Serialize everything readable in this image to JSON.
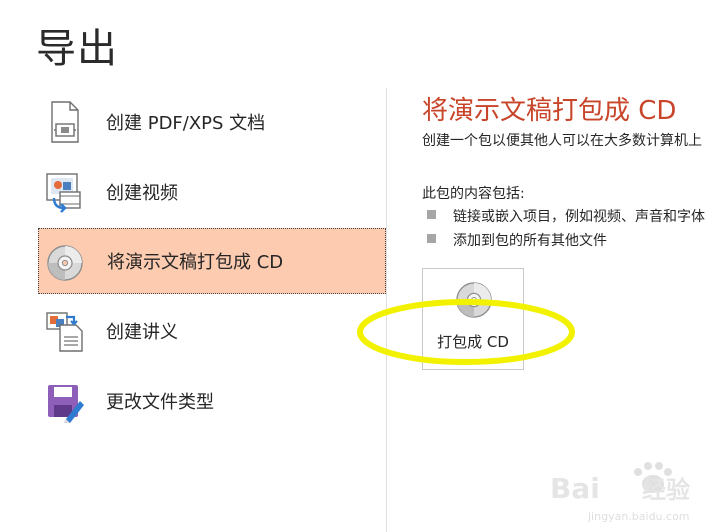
{
  "page": {
    "title": "导出"
  },
  "menu": {
    "items": [
      {
        "label": "创建 PDF/XPS 文档",
        "icon": "pdf-document-icon"
      },
      {
        "label": "创建视频",
        "icon": "video-icon"
      },
      {
        "label": "将演示文稿打包成 CD",
        "icon": "cd-icon"
      },
      {
        "label": "创建讲义",
        "icon": "handout-icon"
      },
      {
        "label": "更改文件类型",
        "icon": "save-as-icon"
      }
    ],
    "selected_index": 2
  },
  "detail": {
    "title": "将演示文稿打包成 CD",
    "description": "创建一个包以便其他人可以在大多数计算机上",
    "contents_heading": "此包的内容包括:",
    "bullets": [
      "链接或嵌入项目，例如视频、声音和字体",
      "添加到包的所有其他文件"
    ],
    "pack_button_label": "打包成 CD"
  },
  "colors": {
    "accent_title": "#c9452a",
    "selected_bg": "#fccbb0",
    "highlight": "#f2f200"
  },
  "watermark": {
    "brand_prefix": "Bai",
    "brand_suffix": "经验",
    "url": "jingyan.baidu.com"
  }
}
